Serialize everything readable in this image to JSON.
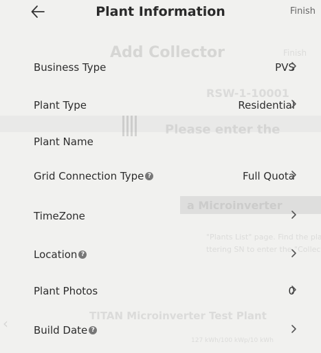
{
  "header": {
    "back_icon": "arrow-left-icon",
    "title": "Plant Information",
    "finish_label": "Finish"
  },
  "background_ghost": {
    "title": "Add Collector",
    "finish": "Finish",
    "sn": "RSW-1-10001",
    "enter": "Please enter the",
    "micro": "a Microinverter",
    "hint1": "\"Plants List\" page. Find the plant and device list, c",
    "hint2": "ttering SN to enter the \"Collector Detail\" page.",
    "test_plant": "TITAN Microinverter Test Plant",
    "test_sub": "127 kWh/100 kWp/10 kWh"
  },
  "rows": [
    {
      "label": "Business Type",
      "value": "PVS",
      "help": false,
      "chevron": true
    },
    {
      "label": "Plant Type",
      "value": "Residential",
      "help": false,
      "chevron": true
    },
    {
      "label": "Plant Name",
      "value": "",
      "help": false,
      "chevron": false
    },
    {
      "label": "Grid Connection Type",
      "value": "Full Quota",
      "help": true,
      "chevron": true
    },
    {
      "label": "TimeZone",
      "value": "",
      "help": false,
      "chevron": true
    },
    {
      "label": "Location",
      "value": "",
      "help": true,
      "chevron": true
    },
    {
      "label": "Plant Photos",
      "value": "0",
      "help": false,
      "chevron": true
    },
    {
      "label": "Build Date",
      "value": "",
      "help": true,
      "chevron": true
    }
  ],
  "icons": {
    "chevron": "chevron-right-icon",
    "help": "help-circle-icon"
  },
  "colors": {
    "background": "#f1f1ef",
    "text": "#2d2d2d",
    "muted": "#666666"
  }
}
